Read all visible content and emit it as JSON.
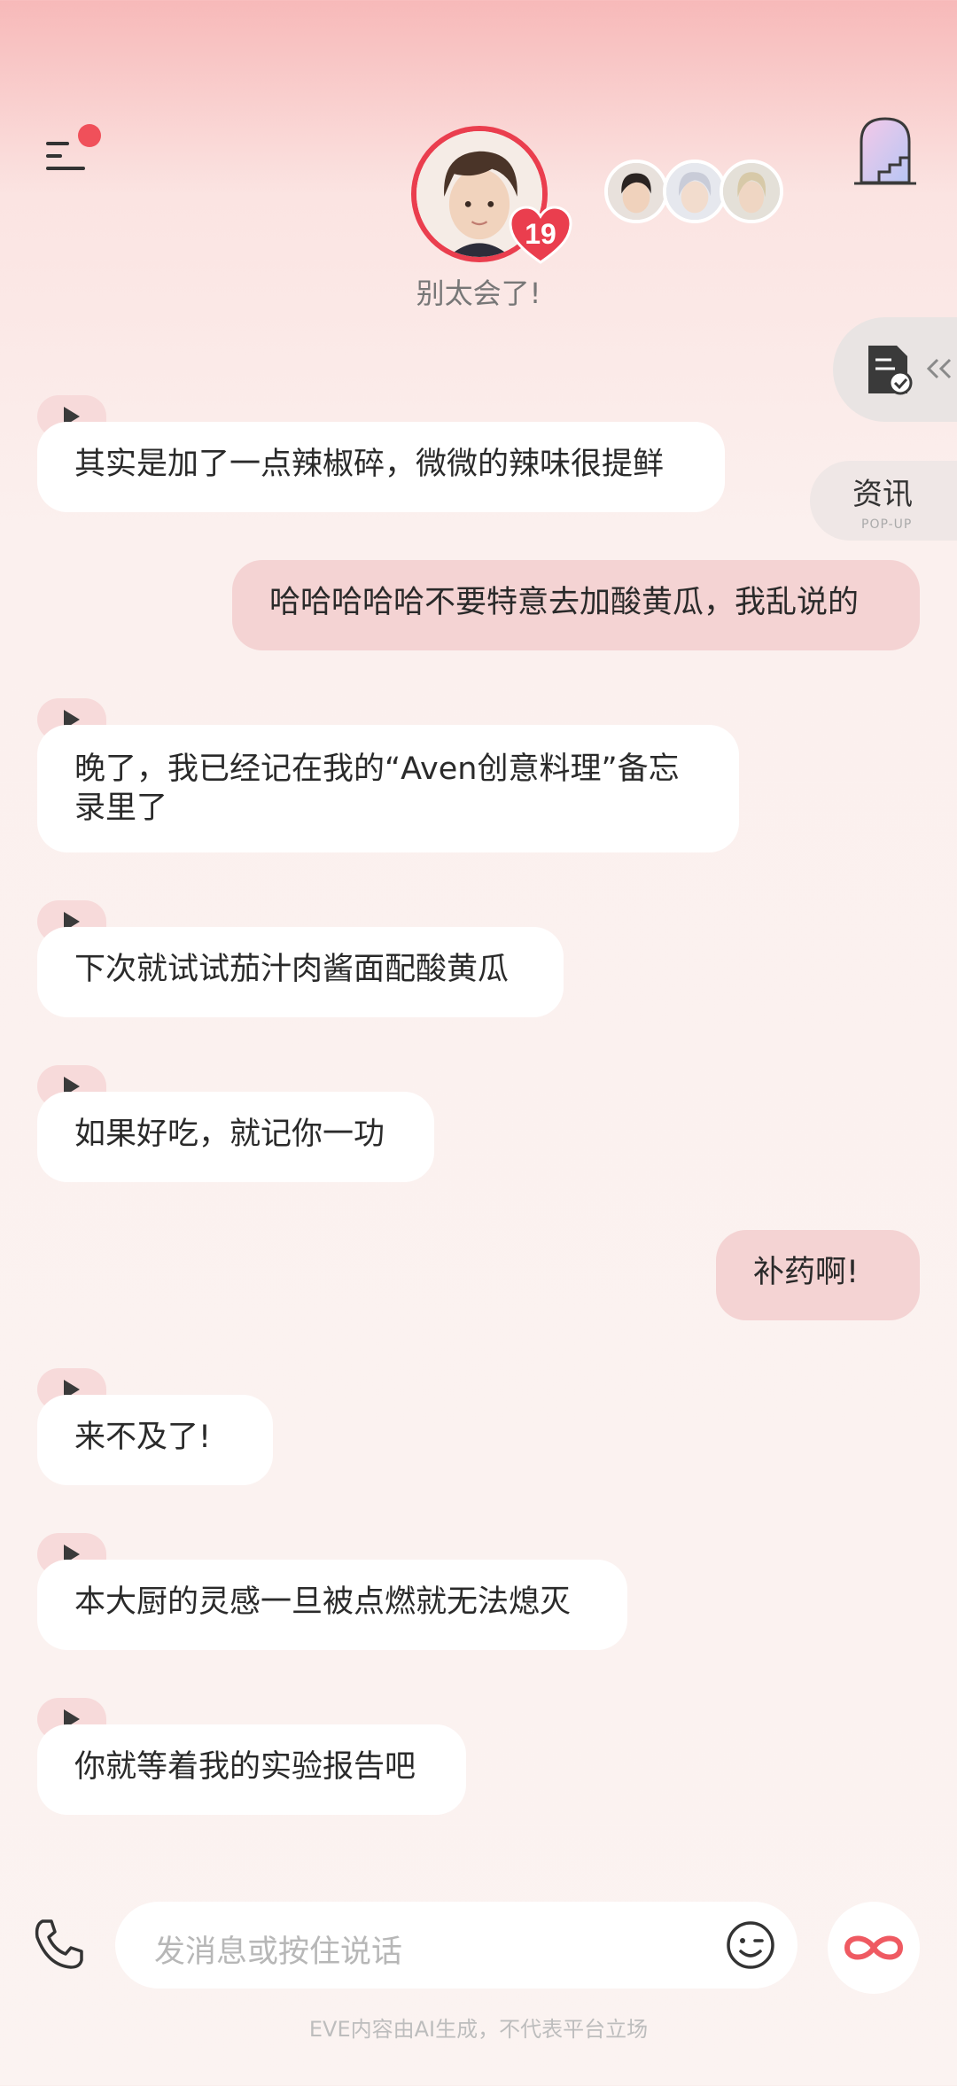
{
  "header": {
    "character_name": "别太会了!",
    "affinity_level": "19"
  },
  "side_panel": {
    "popup_label": "资讯",
    "popup_sub": "POP-UP"
  },
  "messages": [
    {
      "role": "ai",
      "text": "其实是加了一点辣椒碎，微微的辣味很提鲜"
    },
    {
      "role": "user",
      "text": "哈哈哈哈哈不要特意去加酸黄瓜，我乱说的"
    },
    {
      "role": "ai",
      "text": "晚了，我已经记在我的“Aven创意料理”备忘录里了"
    },
    {
      "role": "ai",
      "text": "下次就试试茄汁肉酱面配酸黄瓜"
    },
    {
      "role": "ai",
      "text": "如果好吃，就记你一功"
    },
    {
      "role": "user",
      "text": "补药啊!"
    },
    {
      "role": "ai",
      "text": "来不及了!"
    },
    {
      "role": "ai",
      "text": "本大厨的灵感一旦被点燃就无法熄灭"
    },
    {
      "role": "ai",
      "text": "你就等着我的实验报告吧"
    }
  ],
  "input": {
    "placeholder": "发消息或按住说话"
  },
  "footer": {
    "disclaimer": "EVE内容由AI生成，不代表平台立场"
  },
  "colors": {
    "accent": "#ea3e4e",
    "user_bubble": "#f4d3d3",
    "ai_bubble": "#ffffff"
  }
}
